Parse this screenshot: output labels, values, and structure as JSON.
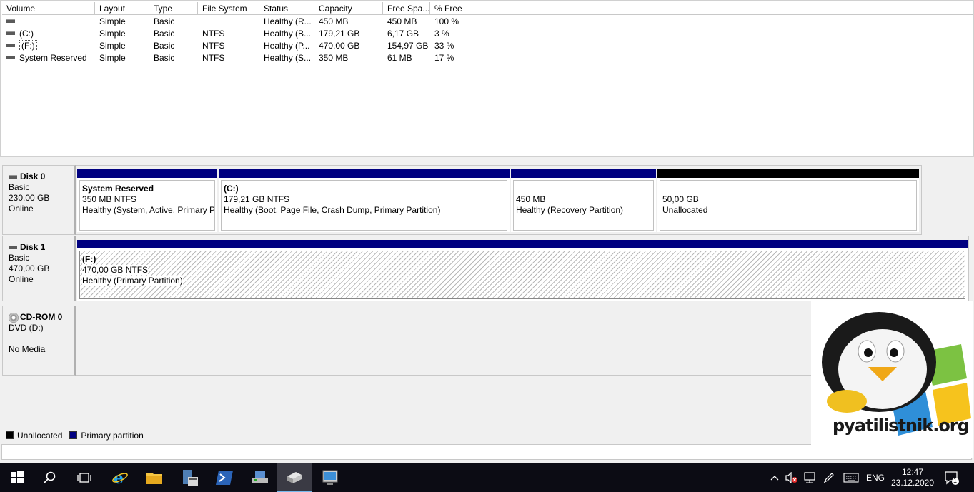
{
  "columns": [
    "Volume",
    "Layout",
    "Type",
    "File System",
    "Status",
    "Capacity",
    "Free Spa...",
    "% Free"
  ],
  "volumes": [
    {
      "name": "",
      "layout": "Simple",
      "type": "Basic",
      "fs": "",
      "status": "Healthy (R...",
      "capacity": "450 MB",
      "free": "450 MB",
      "pct": "100 %"
    },
    {
      "name": "(C:)",
      "layout": "Simple",
      "type": "Basic",
      "fs": "NTFS",
      "status": "Healthy (B...",
      "capacity": "179,21 GB",
      "free": "6,17 GB",
      "pct": "3 %"
    },
    {
      "name": "(F:)",
      "layout": "Simple",
      "type": "Basic",
      "fs": "NTFS",
      "status": "Healthy (P...",
      "capacity": "470,00 GB",
      "free": "154,97 GB",
      "pct": "33 %"
    },
    {
      "name": "System Reserved",
      "layout": "Simple",
      "type": "Basic",
      "fs": "NTFS",
      "status": "Healthy (S...",
      "capacity": "350 MB",
      "free": "61 MB",
      "pct": "17 %"
    }
  ],
  "disks": [
    {
      "name": "Disk 0",
      "type": "Basic",
      "size": "230,00 GB",
      "state": "Online",
      "partitions": [
        {
          "title": "System Reserved",
          "size": "350 MB NTFS",
          "status": "Healthy (System, Active, Primary P",
          "kind": "primary"
        },
        {
          "title": "(C:)",
          "size": "179,21 GB NTFS",
          "status": "Healthy (Boot, Page File, Crash Dump, Primary Partition)",
          "kind": "primary"
        },
        {
          "title": "",
          "size": "450 MB",
          "status": "Healthy (Recovery Partition)",
          "kind": "primary"
        },
        {
          "title": "",
          "size": "50,00 GB",
          "status": "Unallocated",
          "kind": "unallocated"
        }
      ]
    },
    {
      "name": "Disk 1",
      "type": "Basic",
      "size": "470,00 GB",
      "state": "Online",
      "partitions": [
        {
          "title": "(F:)",
          "size": "470,00 GB NTFS",
          "status": "Healthy (Primary Partition)",
          "kind": "primary"
        }
      ]
    }
  ],
  "cdrom": {
    "name": "CD-ROM 0",
    "drive": "DVD (D:)",
    "media": "No Media"
  },
  "legend": [
    {
      "label": "Unallocated",
      "color": "#000000"
    },
    {
      "label": "Primary partition",
      "color": "#000080"
    }
  ],
  "logo": {
    "text": "pyatilistnik.org"
  },
  "taskbar": {
    "language": "ENG",
    "time": "12:47",
    "date": "23.12.2020",
    "notifications": "1",
    "apps": [
      "start-icon",
      "search-icon",
      "task-view-icon",
      "internet-explorer-icon",
      "file-explorer-icon",
      "server-manager-icon",
      "powershell-icon",
      "device-manager-icon",
      "disk-management-icon",
      "remote-desktop-icon"
    ]
  },
  "colors": {
    "primary": "#000080",
    "unallocated": "#000000",
    "taskbar": "#0c0c14"
  }
}
